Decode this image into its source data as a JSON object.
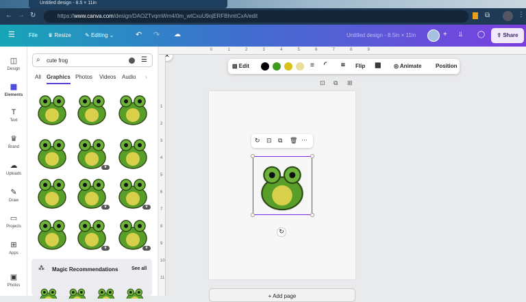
{
  "browser": {
    "tab_title": "Untitled design - 8.5 × 11in",
    "url_prefix": "https://",
    "url_domain": "www.canva.com",
    "url_path": "/design/DAOZTvqmWm4/0m_wtCxuU9ojERFBhmtCxA/edit"
  },
  "topbar": {
    "file": "File",
    "resize": "Resize",
    "editing": "Editing",
    "doc_title": "Untitled design - 8.5in × 11in",
    "share": "Share"
  },
  "rail": [
    {
      "label": "Design",
      "icon": "◫"
    },
    {
      "label": "Elements",
      "icon": "▦"
    },
    {
      "label": "Text",
      "icon": "T"
    },
    {
      "label": "Brand",
      "icon": "♛"
    },
    {
      "label": "Uploads",
      "icon": "☁"
    },
    {
      "label": "Draw",
      "icon": "✎"
    },
    {
      "label": "Projects",
      "icon": "▭"
    },
    {
      "label": "Apps",
      "icon": "⊞"
    },
    {
      "label": "Photos",
      "icon": "▣"
    }
  ],
  "search": {
    "value": "cute frog"
  },
  "tabs": [
    "All",
    "Graphics",
    "Photos",
    "Videos",
    "Audio"
  ],
  "magic": {
    "title": "Magic Recommendations",
    "see_all": "See all"
  },
  "context_toolbar": {
    "edit": "Edit",
    "flip": "Flip",
    "animate": "Animate",
    "position": "Position",
    "colors": [
      "#000000",
      "#3f9a1e",
      "#d8c21a",
      "#e9df9a"
    ]
  },
  "ruler": {
    "top": [
      "0",
      "1",
      "2",
      "3",
      "4",
      "5",
      "6",
      "7",
      "8",
      "9"
    ],
    "left": [
      "1",
      "2",
      "3",
      "4",
      "5",
      "6",
      "7",
      "8",
      "9",
      "10",
      "11"
    ]
  },
  "add_page": "+ Add page"
}
